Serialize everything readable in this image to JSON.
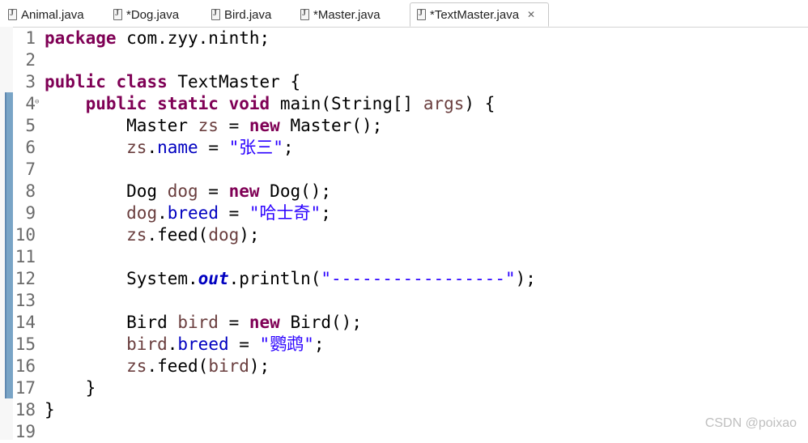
{
  "tabs": [
    {
      "label": "Animal.java"
    },
    {
      "label": "*Dog.java"
    },
    {
      "label": "Bird.java"
    },
    {
      "label": "*Master.java"
    },
    {
      "label": "*TextMaster.java",
      "active": true
    }
  ],
  "editor": {
    "lines": [
      {
        "n": "1",
        "tokens": [
          {
            "t": "kw",
            "v": "package"
          },
          {
            "t": "",
            "v": " com.zyy.ninth;"
          }
        ]
      },
      {
        "n": "2",
        "tokens": []
      },
      {
        "n": "3",
        "tokens": [
          {
            "t": "kw",
            "v": "public"
          },
          {
            "t": "",
            "v": " "
          },
          {
            "t": "kw",
            "v": "class"
          },
          {
            "t": "",
            "v": " TextMaster {"
          }
        ]
      },
      {
        "n": "4",
        "fold": "⊖",
        "tokens": [
          {
            "t": "",
            "v": "    "
          },
          {
            "t": "kw",
            "v": "public"
          },
          {
            "t": "",
            "v": " "
          },
          {
            "t": "kw",
            "v": "static"
          },
          {
            "t": "",
            "v": " "
          },
          {
            "t": "kw",
            "v": "void"
          },
          {
            "t": "",
            "v": " main(String[] "
          },
          {
            "t": "var",
            "v": "args"
          },
          {
            "t": "",
            "v": ") {"
          }
        ]
      },
      {
        "n": "5",
        "tokens": [
          {
            "t": "",
            "v": "        Master "
          },
          {
            "t": "var",
            "v": "zs"
          },
          {
            "t": "",
            "v": " = "
          },
          {
            "t": "kw",
            "v": "new"
          },
          {
            "t": "",
            "v": " Master();"
          }
        ]
      },
      {
        "n": "6",
        "tokens": [
          {
            "t": "",
            "v": "        "
          },
          {
            "t": "var",
            "v": "zs"
          },
          {
            "t": "",
            "v": "."
          },
          {
            "t": "fld",
            "v": "name"
          },
          {
            "t": "",
            "v": " = "
          },
          {
            "t": "str",
            "v": "\"张三\""
          },
          {
            "t": "",
            "v": ";"
          }
        ]
      },
      {
        "n": "7",
        "tokens": []
      },
      {
        "n": "8",
        "tokens": [
          {
            "t": "",
            "v": "        Dog "
          },
          {
            "t": "var",
            "v": "dog"
          },
          {
            "t": "",
            "v": " = "
          },
          {
            "t": "kw",
            "v": "new"
          },
          {
            "t": "",
            "v": " Dog();"
          }
        ]
      },
      {
        "n": "9",
        "tokens": [
          {
            "t": "",
            "v": "        "
          },
          {
            "t": "var",
            "v": "dog"
          },
          {
            "t": "",
            "v": "."
          },
          {
            "t": "fld",
            "v": "breed"
          },
          {
            "t": "",
            "v": " = "
          },
          {
            "t": "str",
            "v": "\"哈士奇\""
          },
          {
            "t": "",
            "v": ";"
          }
        ]
      },
      {
        "n": "10",
        "tokens": [
          {
            "t": "",
            "v": "        "
          },
          {
            "t": "var",
            "v": "zs"
          },
          {
            "t": "",
            "v": ".feed("
          },
          {
            "t": "var",
            "v": "dog"
          },
          {
            "t": "",
            "v": ");"
          }
        ]
      },
      {
        "n": "11",
        "tokens": []
      },
      {
        "n": "12",
        "tokens": [
          {
            "t": "",
            "v": "        System."
          },
          {
            "t": "sfld",
            "v": "out"
          },
          {
            "t": "",
            "v": ".println("
          },
          {
            "t": "str",
            "v": "\"-----------------\""
          },
          {
            "t": "",
            "v": ");"
          }
        ]
      },
      {
        "n": "13",
        "tokens": []
      },
      {
        "n": "14",
        "tokens": [
          {
            "t": "",
            "v": "        Bird "
          },
          {
            "t": "var",
            "v": "bird"
          },
          {
            "t": "",
            "v": " = "
          },
          {
            "t": "kw",
            "v": "new"
          },
          {
            "t": "",
            "v": " Bird();"
          }
        ]
      },
      {
        "n": "15",
        "tokens": [
          {
            "t": "",
            "v": "        "
          },
          {
            "t": "var",
            "v": "bird"
          },
          {
            "t": "",
            "v": "."
          },
          {
            "t": "fld",
            "v": "breed"
          },
          {
            "t": "",
            "v": " = "
          },
          {
            "t": "str",
            "v": "\"鹦鹉\""
          },
          {
            "t": "",
            "v": ";"
          }
        ]
      },
      {
        "n": "16",
        "tokens": [
          {
            "t": "",
            "v": "        "
          },
          {
            "t": "var",
            "v": "zs"
          },
          {
            "t": "",
            "v": ".feed("
          },
          {
            "t": "var",
            "v": "bird"
          },
          {
            "t": "",
            "v": ");"
          }
        ]
      },
      {
        "n": "17",
        "tokens": [
          {
            "t": "",
            "v": "    }"
          }
        ]
      },
      {
        "n": "18",
        "tokens": [
          {
            "t": "",
            "v": "}"
          }
        ]
      },
      {
        "n": "19",
        "tokens": []
      }
    ]
  },
  "watermark": "CSDN @poixao",
  "colors": {
    "keyword": "#7f0055",
    "string": "#2a00ff",
    "field": "#0000c0",
    "local_variable": "#6a3e3e",
    "change_marker": "#79a4c6"
  }
}
